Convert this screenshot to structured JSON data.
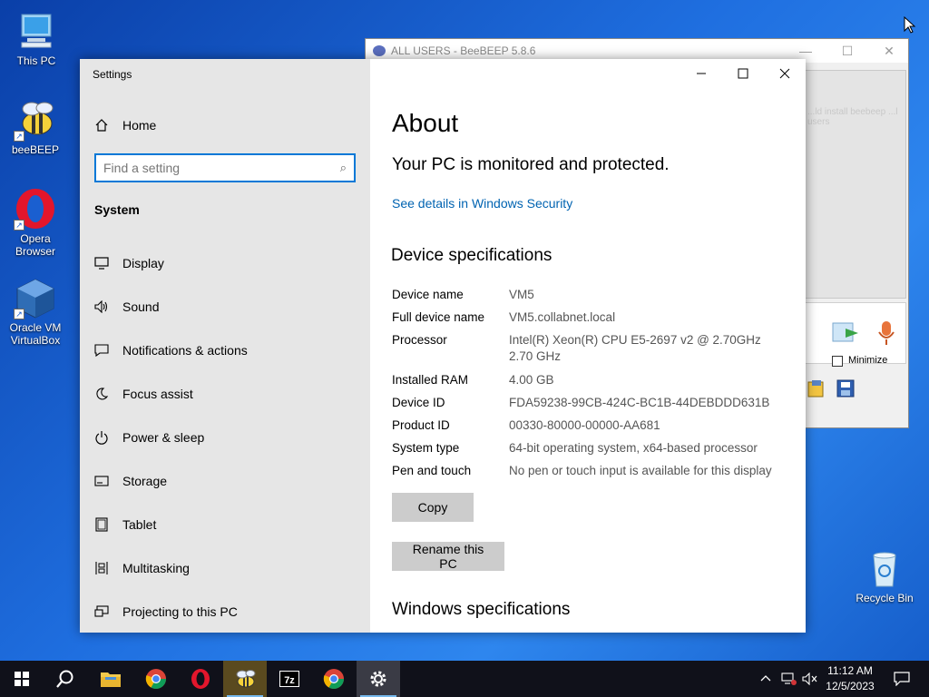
{
  "desktop": {
    "icons": [
      {
        "label": "This PC"
      },
      {
        "label": "beeBEEP"
      },
      {
        "label": "Opera Browser"
      },
      {
        "label": "Oracle VM VirtualBox"
      },
      {
        "label": "Recycle Bin"
      }
    ]
  },
  "beebeep": {
    "title": "ALL USERS - BeeBEEP 5.8.6",
    "panel_hint": "...ld install beebeep ...l users",
    "minimize_label": "Minimize"
  },
  "settings": {
    "window_title": "Settings",
    "home_label": "Home",
    "search_placeholder": "Find a setting",
    "section_label": "System",
    "nav": [
      {
        "label": "Display",
        "icon": "display-icon"
      },
      {
        "label": "Sound",
        "icon": "sound-icon"
      },
      {
        "label": "Notifications & actions",
        "icon": "notifications-icon"
      },
      {
        "label": "Focus assist",
        "icon": "moon-icon"
      },
      {
        "label": "Power & sleep",
        "icon": "power-icon"
      },
      {
        "label": "Storage",
        "icon": "storage-icon"
      },
      {
        "label": "Tablet",
        "icon": "tablet-icon"
      },
      {
        "label": "Multitasking",
        "icon": "multitasking-icon"
      },
      {
        "label": "Projecting to this PC",
        "icon": "projecting-icon"
      }
    ],
    "main": {
      "heading": "About",
      "protection_status": "Your PC is monitored and protected.",
      "security_link": "See details in Windows Security",
      "device_spec_heading": "Device specifications",
      "specs": [
        {
          "key": "Device name",
          "value": "VM5"
        },
        {
          "key": "Full device name",
          "value": "VM5.collabnet.local"
        },
        {
          "key": "Processor",
          "value": "Intel(R) Xeon(R) CPU E5-2697 v2 @ 2.70GHz",
          "value2": "2.70 GHz"
        },
        {
          "key": "Installed RAM",
          "value": "4.00 GB"
        },
        {
          "key": "Device ID",
          "value": "FDA59238-99CB-424C-BC1B-44DEBDDD631B"
        },
        {
          "key": "Product ID",
          "value": "00330-80000-00000-AA681"
        },
        {
          "key": "System type",
          "value": "64-bit operating system, x64-based processor"
        },
        {
          "key": "Pen and touch",
          "value": "No pen or touch input is available for this display"
        }
      ],
      "copy_button": "Copy",
      "rename_button": "Rename this PC",
      "windows_spec_heading": "Windows specifications"
    }
  },
  "taskbar": {
    "time": "11:12 AM",
    "date": "12/5/2023",
    "items": [
      "start-button",
      "search-button",
      "file-explorer",
      "chrome",
      "opera",
      "beebeep",
      "7zip",
      "chrome",
      "settings"
    ]
  },
  "colors": {
    "accent": "#0078d7",
    "link": "#0063b1",
    "sidebar_bg": "#e6e6e6",
    "taskbar_bg": "#10111a"
  }
}
